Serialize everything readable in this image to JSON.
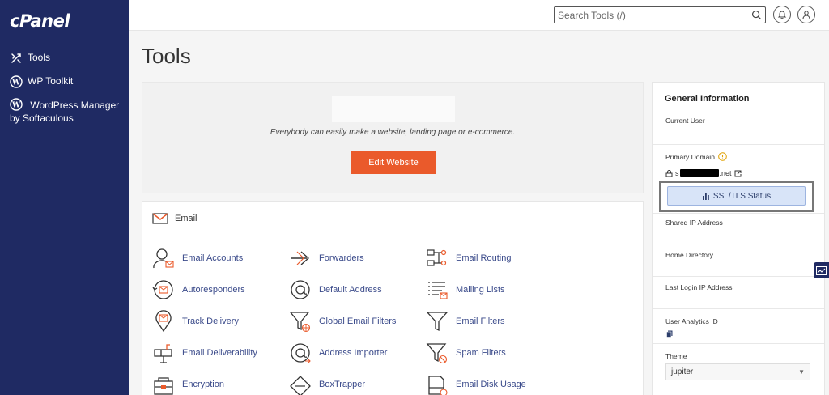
{
  "sidebar": {
    "logo": "cPanel",
    "items": [
      {
        "label": "Tools",
        "icon": "tools-icon"
      },
      {
        "label": "WP Toolkit",
        "icon": "wordpress-icon"
      },
      {
        "label": "WordPress Manager by Softaculous",
        "icon": "wordpress-icon"
      }
    ]
  },
  "topbar": {
    "search_placeholder": "Search Tools (/)",
    "notifications_icon": "bell-icon",
    "user_icon": "user-icon"
  },
  "page": {
    "title": "Tools"
  },
  "website": {
    "tagline": "Everybody can easily make a website, landing page or e-commerce.",
    "edit_label": "Edit Website"
  },
  "email": {
    "heading": "Email",
    "tools": [
      {
        "label": "Email Accounts",
        "icon": "email-accounts-icon"
      },
      {
        "label": "Forwarders",
        "icon": "forwarders-icon"
      },
      {
        "label": "Email Routing",
        "icon": "email-routing-icon"
      },
      {
        "label": "Autoresponders",
        "icon": "autoresponders-icon"
      },
      {
        "label": "Default Address",
        "icon": "default-address-icon"
      },
      {
        "label": "Mailing Lists",
        "icon": "mailing-lists-icon"
      },
      {
        "label": "Track Delivery",
        "icon": "track-delivery-icon"
      },
      {
        "label": "Global Email Filters",
        "icon": "global-email-filters-icon"
      },
      {
        "label": "Email Filters",
        "icon": "email-filters-icon"
      },
      {
        "label": "Email Deliverability",
        "icon": "email-deliverability-icon"
      },
      {
        "label": "Address Importer",
        "icon": "address-importer-icon"
      },
      {
        "label": "Spam Filters",
        "icon": "spam-filters-icon"
      },
      {
        "label": "Encryption",
        "icon": "encryption-icon"
      },
      {
        "label": "BoxTrapper",
        "icon": "boxtrapper-icon"
      },
      {
        "label": "Email Disk Usage",
        "icon": "email-disk-usage-icon"
      }
    ]
  },
  "general_info": {
    "title": "General Information",
    "current_user_label": "Current User",
    "primary_domain_label": "Primary Domain",
    "domain_prefix": "s",
    "domain_suffix": ".net",
    "ssl_button": "SSL/TLS Status",
    "shared_ip_label": "Shared IP Address",
    "home_dir_label": "Home Directory",
    "last_login_label": "Last Login IP Address",
    "analytics_label": "User Analytics ID",
    "theme_label": "Theme",
    "theme_value": "jupiter"
  },
  "colors": {
    "sidebar_bg": "#1f2a63",
    "accent_orange": "#ea5a2b",
    "link_blue": "#3a4a8a",
    "info_yellow": "#e0a100"
  }
}
